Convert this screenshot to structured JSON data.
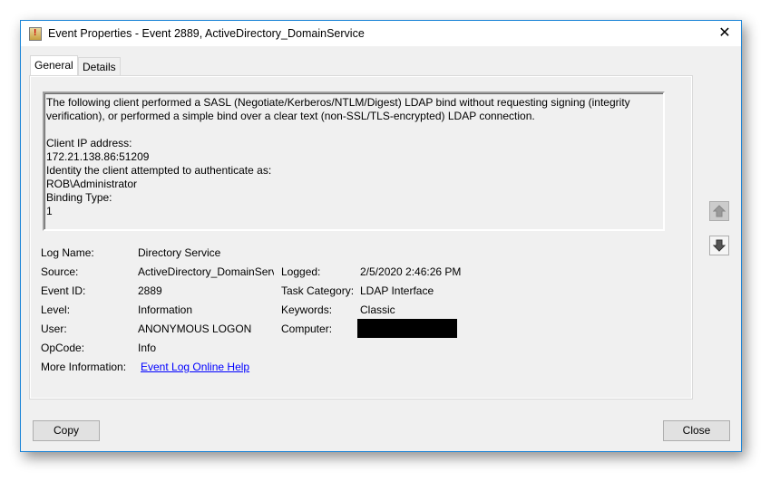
{
  "window": {
    "title": "Event Properties - Event 2889, ActiveDirectory_DomainService",
    "close": "✕"
  },
  "tabs": [
    {
      "label": "General"
    },
    {
      "label": "Details"
    }
  ],
  "description": {
    "lines": [
      "The following client performed a SASL (Negotiate/Kerberos/NTLM/Digest) LDAP bind without requesting signing (integrity verification), or performed a simple bind over a clear text (non-SSL/TLS-encrypted) LDAP connection.",
      "",
      "Client IP address:",
      "172.21.138.86:51209",
      "Identity the client attempted to authenticate as:",
      "ROB\\Administrator",
      "Binding Type:",
      "1"
    ]
  },
  "properties": {
    "log_name": {
      "label": "Log Name:",
      "value": "Directory Service"
    },
    "source": {
      "label": "Source:",
      "value": "ActiveDirectory_DomainServ"
    },
    "event_id": {
      "label": "Event ID:",
      "value": "2889"
    },
    "level": {
      "label": "Level:",
      "value": "Information"
    },
    "user": {
      "label": "User:",
      "value": "ANONYMOUS LOGON"
    },
    "opcode": {
      "label": "OpCode:",
      "value": "Info"
    },
    "more_info": {
      "label": "More Information:",
      "value": "Event Log Online Help"
    },
    "logged": {
      "label": "Logged:",
      "value": "2/5/2020 2:46:26 PM"
    },
    "task_category": {
      "label": "Task Category:",
      "value": "LDAP Interface"
    },
    "keywords": {
      "label": "Keywords:",
      "value": "Classic"
    },
    "computer": {
      "label": "Computer:"
    }
  },
  "buttons": {
    "copy": "Copy",
    "close": "Close"
  },
  "icons": {
    "up": "arrow-up-icon",
    "down": "arrow-down-icon"
  }
}
